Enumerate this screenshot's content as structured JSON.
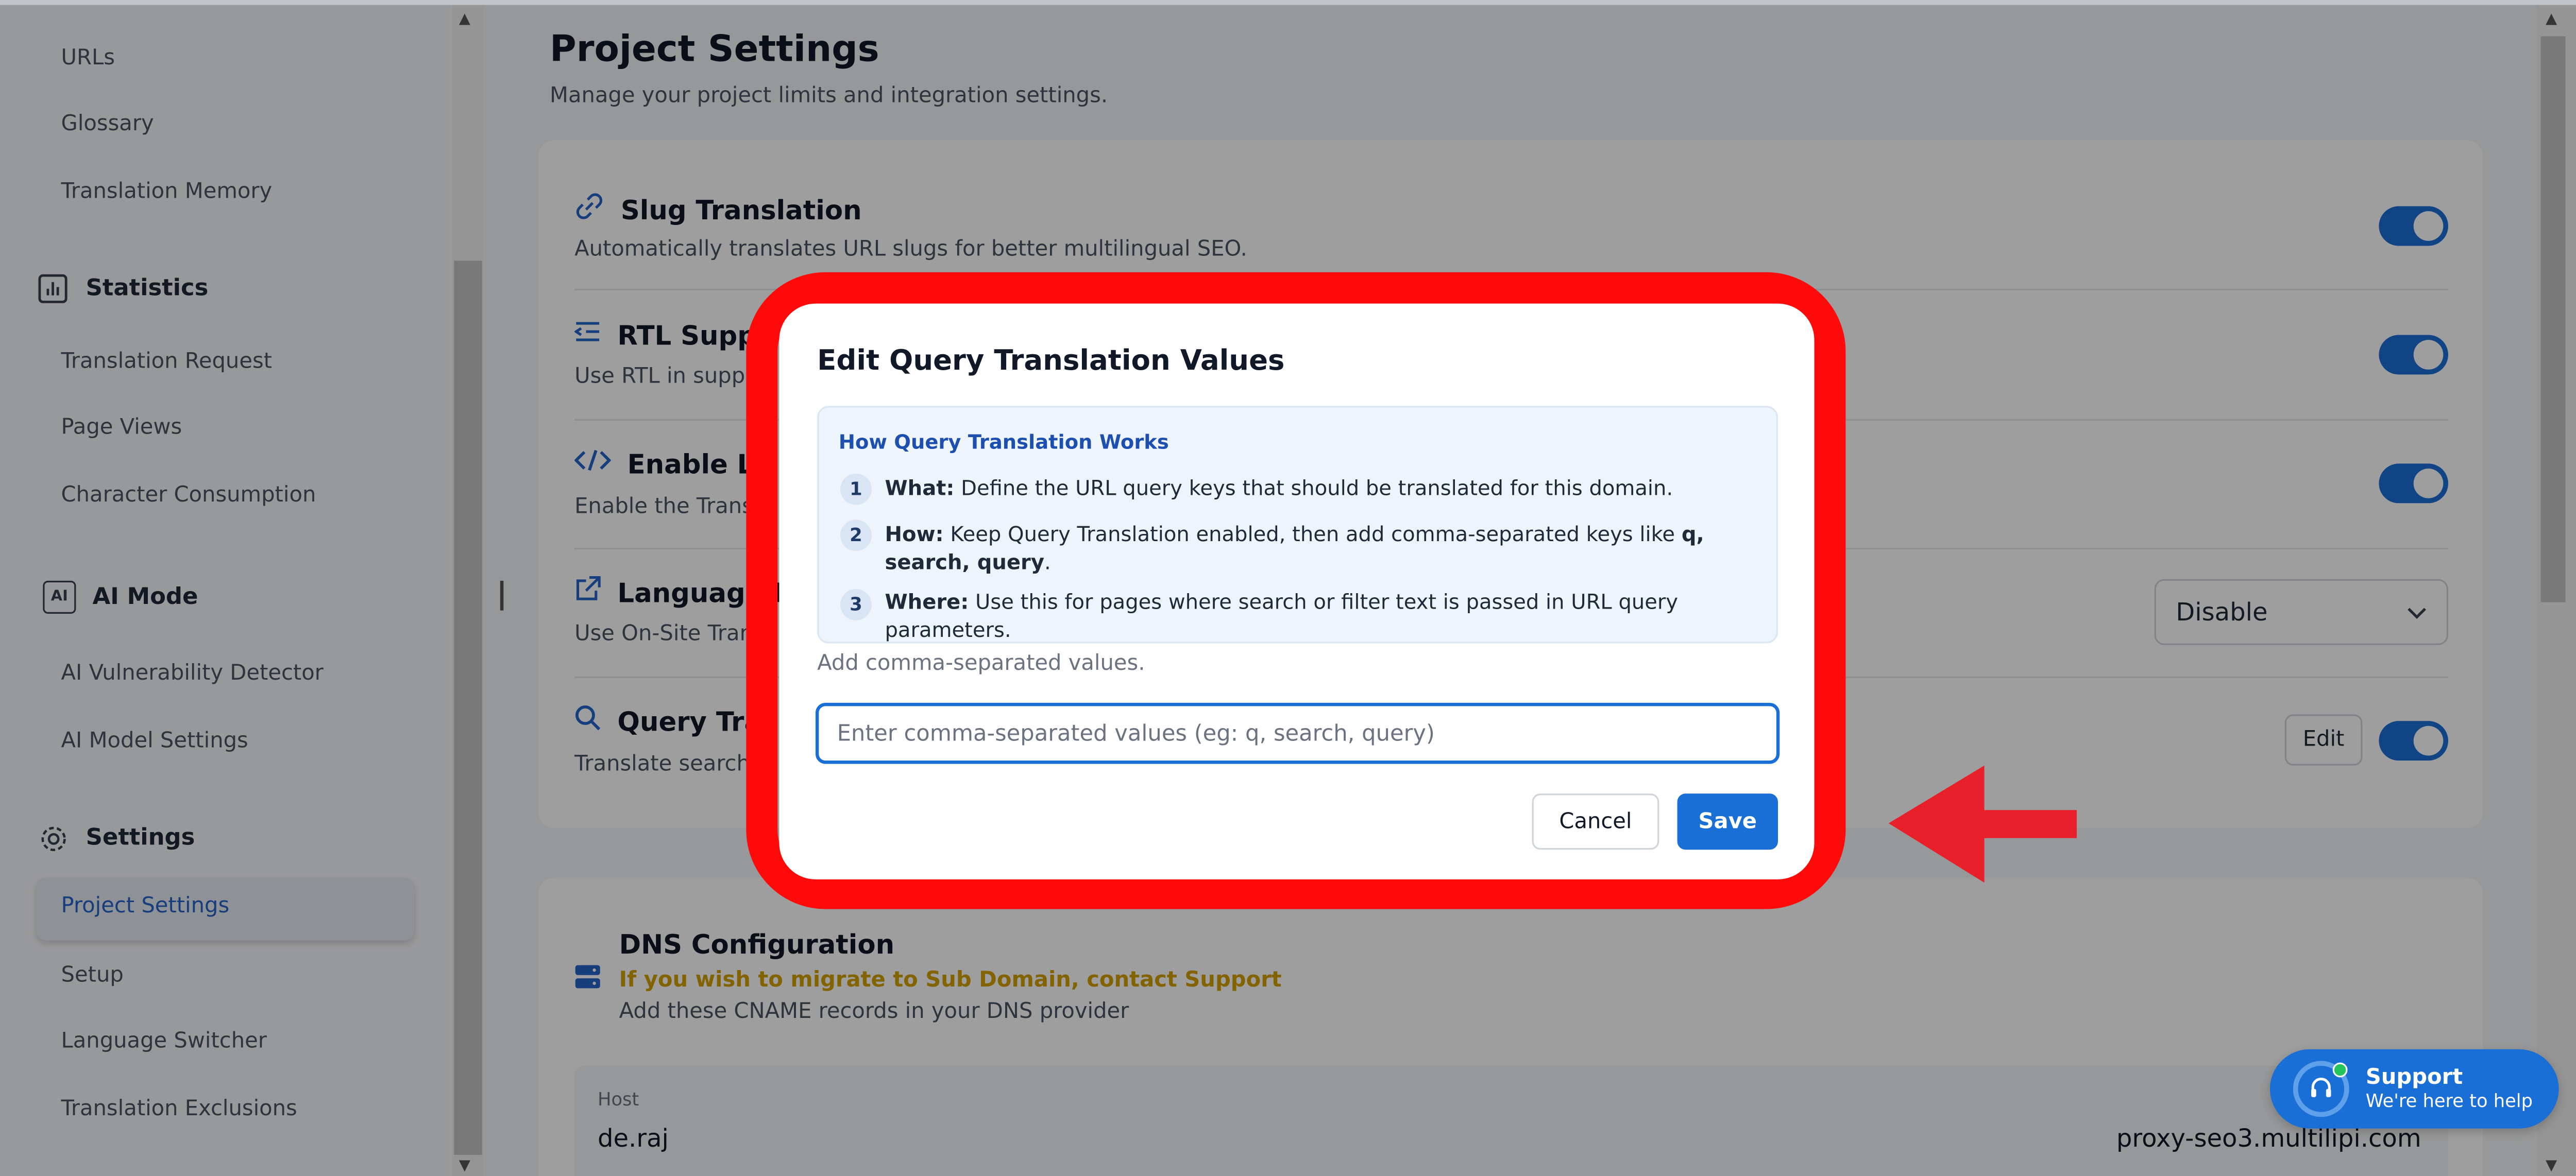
{
  "sidebar": {
    "links_top": [
      "URLs",
      "Glossary",
      "Translation Memory"
    ],
    "statistics": {
      "title": "Statistics",
      "items": [
        "Translation Request",
        "Page Views",
        "Character Consumption"
      ]
    },
    "ai_mode": {
      "title": "AI Mode",
      "icon_label": "AI",
      "items": [
        "AI Vulnerability Detector",
        "AI Model Settings"
      ]
    },
    "settings": {
      "title": "Settings",
      "items": [
        "Project Settings",
        "Setup",
        "Language Switcher",
        "Translation Exclusions"
      ],
      "active": "Project Settings"
    }
  },
  "page": {
    "title": "Project Settings",
    "subtitle": "Manage your project limits and integration settings."
  },
  "settings_rows": [
    {
      "title": "Slug Translation",
      "desc": "Automatically translates URL slugs for better multilingual SEO.",
      "icon": "link-icon",
      "enabled": true
    },
    {
      "title": "RTL Suppo",
      "desc": "Use RTL in suppo",
      "icon": "rtl-icon",
      "enabled": true
    },
    {
      "title": "Enable La",
      "desc": "Enable the Trans",
      "icon": "code-icon",
      "enabled": true
    },
    {
      "title": "Language R",
      "desc": "Use On-Site Tran",
      "icon": "external-link-icon",
      "select_value": "Disable"
    },
    {
      "title": "Query Tra",
      "desc": "Translate search",
      "icon": "search-icon",
      "enabled": true,
      "edit_label": "Edit"
    }
  ],
  "dns": {
    "title": "DNS Configuration",
    "warning": "If you wish to migrate to Sub Domain, contact Support",
    "desc": "Add these CNAME records in your DNS provider",
    "host_label": "Host",
    "host_value": "de.raj",
    "target_value": "proxy-seo3.multilipi.com"
  },
  "support": {
    "title": "Support",
    "subtitle": "We're here to help"
  },
  "modal": {
    "title": "Edit Query Translation Values",
    "info_title": "How Query Translation Works",
    "steps": [
      {
        "num": "1",
        "label": "What:",
        "text": " Define the URL query keys that should be translated for this domain."
      },
      {
        "num": "2",
        "label": "How:",
        "text": " Keep Query Translation enabled, then add comma-separated keys like ",
        "bold_tail": "q, search, query",
        "tail_end": "."
      },
      {
        "num": "3",
        "label": "Where:",
        "text": " Use this for pages where search or filter text is passed in URL query parameters."
      }
    ],
    "input_label": "Add comma-separated values.",
    "input_placeholder": "Enter comma-separated values (eg: q, search, query)",
    "input_value": "",
    "cancel_label": "Cancel",
    "save_label": "Save"
  },
  "colors": {
    "accent": "#1a6fd6",
    "highlight": "#ff0a0a",
    "warning": "#d4a000"
  }
}
